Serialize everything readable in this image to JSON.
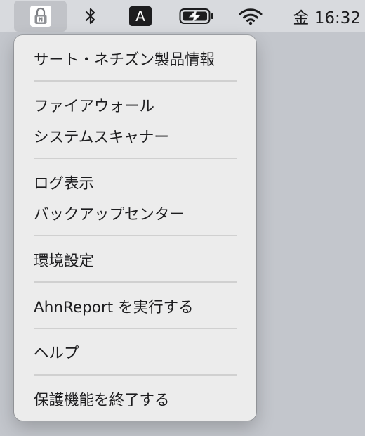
{
  "menubar": {
    "app_icon": "ahnlab-v3-lock-icon",
    "bluetooth_icon": "bluetooth-icon",
    "input_source_letter": "A",
    "battery_icon": "battery-charging-icon",
    "wifi_icon": "wifi-icon",
    "clock": "金 16:32"
  },
  "menu": {
    "items": [
      "サート・ネチズン製品情報",
      "ファイアウォール",
      "システムスキャナー",
      "ログ表示",
      "バックアップセンター",
      "環境設定",
      "AhnReport を実行する",
      "ヘルプ",
      "保護機能を終了する"
    ]
  },
  "colors": {
    "menu_background": "#ececec",
    "menubar_background": "#d8dade",
    "desktop": "#c3c6cc",
    "separator": "#d0d0d0",
    "text": "#1d1d1f"
  }
}
